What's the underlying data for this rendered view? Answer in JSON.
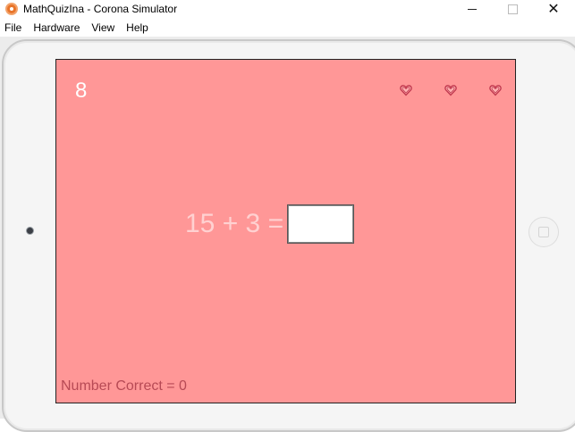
{
  "window": {
    "title": "MathQuizIna - Corona Simulator",
    "minimize_glyph": "",
    "close_glyph": "✕"
  },
  "menu": {
    "items": [
      {
        "label": "File"
      },
      {
        "label": "Hardware"
      },
      {
        "label": "View"
      },
      {
        "label": "Help"
      }
    ]
  },
  "game": {
    "timer": "8",
    "lives": [
      {
        "icon": "heart-icon"
      },
      {
        "icon": "heart-icon"
      },
      {
        "icon": "heart-icon"
      }
    ],
    "question": "15 + 3 =",
    "answer_value": "",
    "score_text": "Number Correct = 0",
    "background_color": "#ff9797",
    "heart_color": "#c23a4f"
  }
}
